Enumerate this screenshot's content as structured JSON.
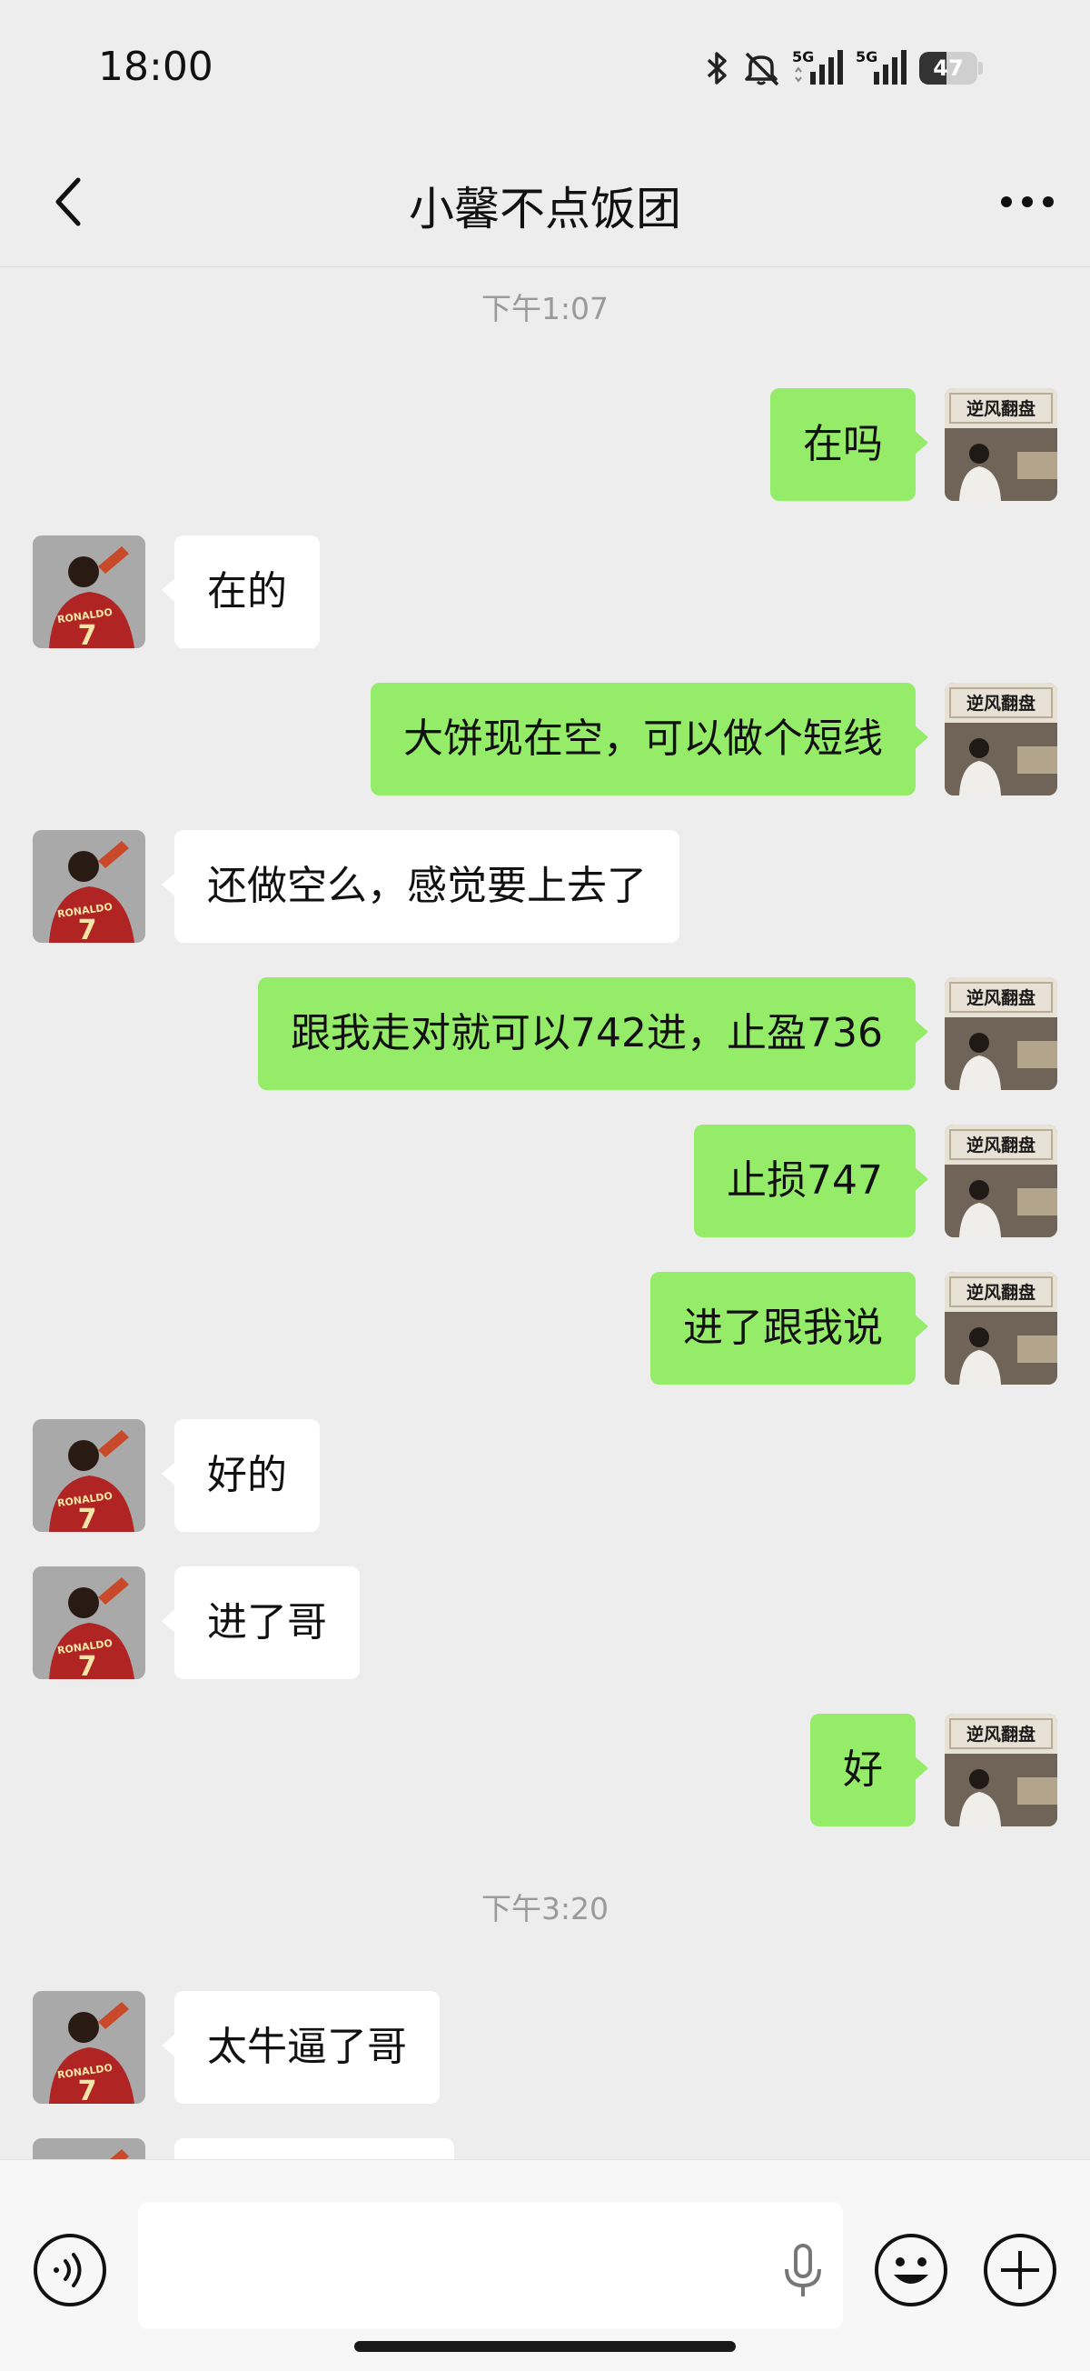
{
  "status_bar": {
    "time": "18:00",
    "battery": "47",
    "battery_level": 0.47,
    "icons": [
      "bluetooth-icon",
      "mute-bell-icon",
      "5g-signal-icon",
      "5g-signal-icon",
      "battery-icon"
    ],
    "network_label_1": "5G",
    "network_label_2": "5G"
  },
  "header": {
    "title": "小馨不点饭团",
    "back_icon": "chevron-left-icon",
    "more_icon": "more-dots-icon"
  },
  "colors": {
    "background": "#ededed",
    "outgoing_bubble": "#95ec69",
    "incoming_bubble": "#ffffff",
    "timestamp": "#9a9a9a"
  },
  "timestamps": [
    "下午1:07",
    "下午3:20"
  ],
  "messages": [
    {
      "sender": "me",
      "text": "在吗"
    },
    {
      "sender": "contact",
      "text": "在的"
    },
    {
      "sender": "me",
      "text": "大饼现在空，可以做个短线"
    },
    {
      "sender": "contact",
      "text": "还做空么，感觉要上去了"
    },
    {
      "sender": "me",
      "text": "跟我走对就可以742进，止盈736"
    },
    {
      "sender": "me",
      "text": "止损747"
    },
    {
      "sender": "me",
      "text": "进了跟我说"
    },
    {
      "sender": "contact",
      "text": "好的"
    },
    {
      "sender": "contact",
      "text": "进了哥"
    },
    {
      "sender": "me",
      "text": "好"
    },
    {
      "sender": "contact",
      "text": "太牛逼了哥"
    }
  ],
  "avatars": {
    "me_text": "逆风翻盘",
    "contact_text": "RONALDO",
    "contact_number": "7"
  },
  "input_bar": {
    "placeholder": "",
    "voice_icon": "voice-icon",
    "mic_icon": "microphone-icon",
    "emoji_icon": "emoji-icon",
    "plus_icon": "plus-icon"
  }
}
